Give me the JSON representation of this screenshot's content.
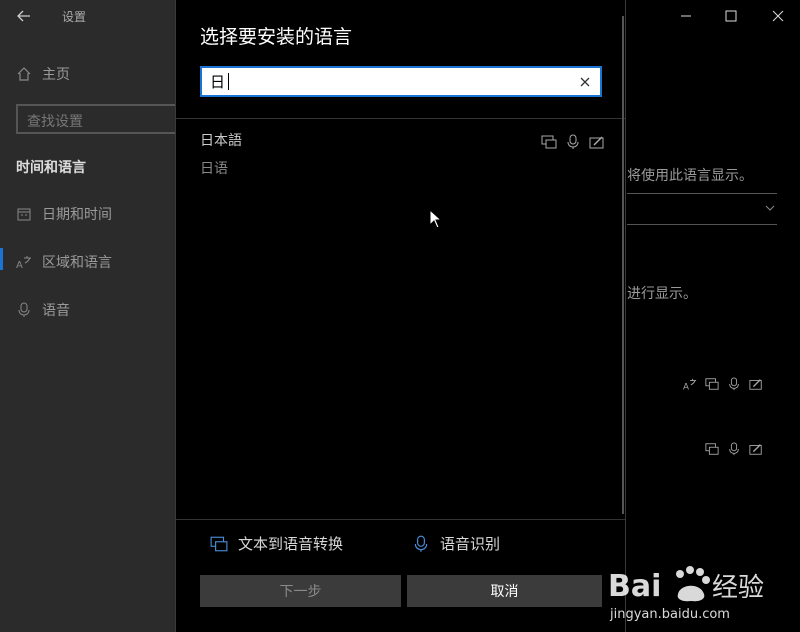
{
  "window": {
    "title": "设置",
    "minimize_icon": "minimize-icon",
    "maximize_icon": "maximize-icon",
    "close_icon": "close-icon"
  },
  "sidebar": {
    "home_label": "主页",
    "search_placeholder": "查找设置",
    "section_title": "时间和语言",
    "items": [
      {
        "label": "日期和时间",
        "icon": "calendar-icon"
      },
      {
        "label": "区域和语言",
        "icon": "language-icon",
        "selected": true
      },
      {
        "label": "语音",
        "icon": "microphone-icon"
      }
    ]
  },
  "background_page": {
    "text_1": "将使用此语言显示。",
    "text_2": "进行显示。"
  },
  "dialog": {
    "title": "选择要安装的语言",
    "search_value": "日",
    "results": [
      {
        "native_name": "日本語",
        "local_name": "日语",
        "features": [
          "display-icon",
          "microphone-icon",
          "handwriting-icon"
        ]
      }
    ],
    "legend": {
      "tts_label": "文本到语音转换",
      "speech_label": "语音识别"
    },
    "next_label": "下一步",
    "cancel_label": "取消"
  },
  "watermark": {
    "text": "Baidu经验",
    "url": "jingyan.baidu.com"
  },
  "colors": {
    "accent": "#1a74d3",
    "sidebar_bg": "#2b2b2b",
    "dialog_bg": "#000000"
  }
}
